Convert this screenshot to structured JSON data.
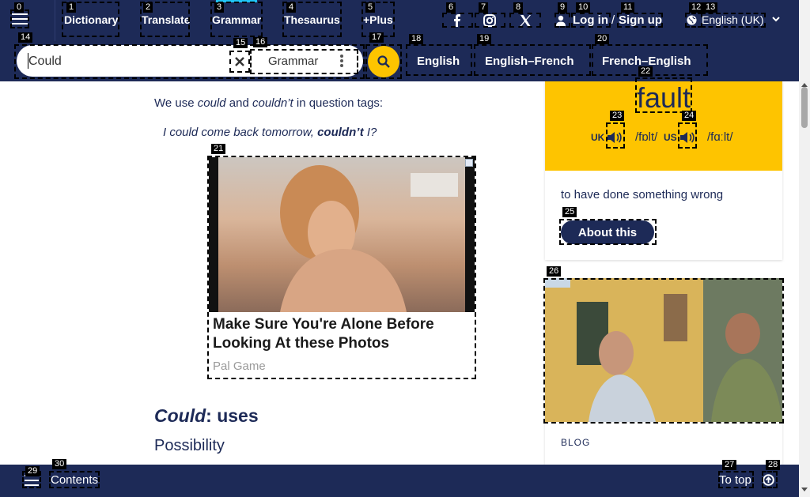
{
  "header": {
    "nav": [
      "Dictionary",
      "Translate",
      "Grammar",
      "Thesaurus",
      "+Plus"
    ],
    "active_nav": "Grammar",
    "social": [
      "facebook-icon",
      "instagram-icon",
      "x-icon"
    ],
    "login": "Log in",
    "separator": "/",
    "signup": "Sign up",
    "language": "English (UK)"
  },
  "search": {
    "value": "Could",
    "dictionary": "Grammar",
    "tabs": [
      "English",
      "English–French",
      "French–English"
    ]
  },
  "article": {
    "intro_pre": "We use ",
    "intro_could": "could",
    "intro_and": " and ",
    "intro_couldnt": "couldn’t",
    "intro_post": " in question tags:",
    "example_pre": "I could come back tomorrow, ",
    "example_bold": "couldn’t",
    "example_post": " I?",
    "section_word": "Could",
    "section_rest": ": uses",
    "subsection": "Possibility"
  },
  "ad": {
    "title": "Make Sure You're Alone Before Looking At these Photos",
    "source": "Pal Game"
  },
  "word_of_day": {
    "word": "fault",
    "uk_label": "UK",
    "uk_ipa": "/fɒlt/",
    "us_label": "US",
    "us_ipa": "/fɑːlt/",
    "definition": "to have done something wrong",
    "button": "About this"
  },
  "blog": {
    "label": "BLOG"
  },
  "footer": {
    "contents": "Contents",
    "to_top": "To top"
  },
  "marker_labels": [
    "0",
    "1",
    "2",
    "3",
    "4",
    "5",
    "6",
    "7",
    "8",
    "9",
    "10",
    "11",
    "12",
    "13",
    "14",
    "15",
    "16",
    "17",
    "18",
    "19",
    "20",
    "21",
    "22",
    "23",
    "24",
    "25",
    "26",
    "27",
    "28",
    "29",
    "30"
  ],
  "colors": {
    "navy": "#1d2a57",
    "yellow": "#fec400",
    "accent": "#20c4f4"
  }
}
